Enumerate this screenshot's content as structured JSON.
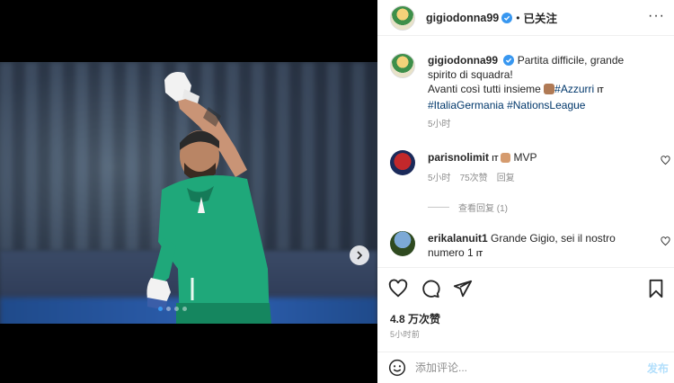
{
  "post": {
    "username": "gigiodonna99",
    "follow_status": "已关注",
    "caption_line1": "Partita difficile, grande spirito di squadra!",
    "caption_line2_text": "Avanti così tutti insieme ",
    "caption_tags": [
      "#Azzurri",
      "#ItaliaGermania",
      "#NationsLeague"
    ],
    "caption_time": "5小时",
    "flag_label": "IT"
  },
  "comments": [
    {
      "username": "parisnolimit",
      "text": "MVP",
      "flag_label": "IT",
      "time": "5小时",
      "likes": "75次赞",
      "reply": "回复",
      "view_replies": "查看回复 (1)"
    },
    {
      "username": "erikalanuit1",
      "text": "Grande Gigio, sei il nostro numero 1",
      "flag_label": "IT"
    }
  ],
  "stats": {
    "likes": "4.8 万次赞",
    "time": "5小时前"
  },
  "composer": {
    "placeholder": "添加评论...",
    "post_label": "发布"
  },
  "carousel": {
    "dot_count": 4,
    "active_index": 0
  },
  "colors": {
    "accent": "#3897f0",
    "link": "#00376b",
    "muted": "#8e8e8e",
    "post_disabled": "#b2dffc"
  }
}
